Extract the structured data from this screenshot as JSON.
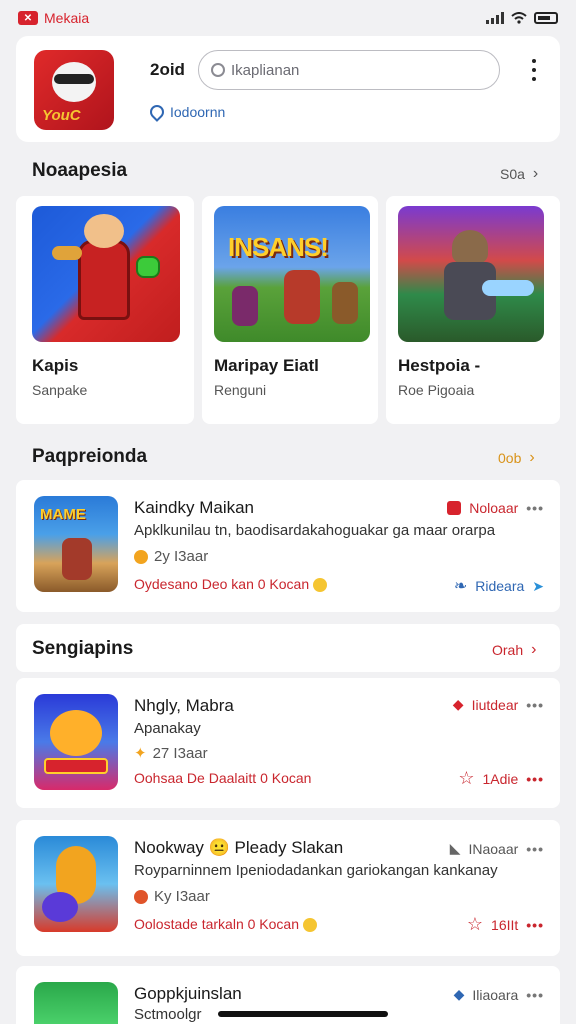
{
  "status": {
    "app_label": "Mekaia"
  },
  "header": {
    "tag": "2oid",
    "search_placeholder": "Ikaplianan",
    "location": "Iodoornn"
  },
  "featured": {
    "title": "Noaapesia",
    "see_all": "S0a",
    "items": [
      {
        "name": "Kapis",
        "sub": "Sanpake"
      },
      {
        "name": "Maripay Eiatl",
        "sub": "Renguni",
        "banner": "INSANS!"
      },
      {
        "name": "Hestpoia -",
        "sub": "Roe Pigoaia"
      }
    ]
  },
  "popular": {
    "title": "Paqpreionda",
    "see_all": "0ob",
    "card": {
      "thumb_text": "MAME",
      "title": "Kaindky Maikan",
      "desc": "Apklkunilau tn, baodisardakahoguakar ga maar orarpa",
      "meta": "2y I3aar",
      "footer": "Oydesano Deo kan 0 Kocan",
      "badge": "Noloaar",
      "more": "•••",
      "action": "Rideara"
    }
  },
  "sengapires": {
    "title": "Sengiapins",
    "see_all": "Orah",
    "cards": [
      {
        "title": "Nhgly, Mabra",
        "desc": "Apanakay",
        "meta": "27 I3aar",
        "footer": "Oohsaa De Daalaitt 0 Kocan",
        "badge": "Iiutdear",
        "more": "•••",
        "rating": "1Adie"
      },
      {
        "title": "Nookway 😐 Pleady Slakan",
        "desc": "Royparninnem Ipeniodadankan gariokangan kankanay",
        "meta": "Ky I3aar",
        "footer": "Oolostade tarkaln 0 Kocan",
        "badge": "INaoaar",
        "more": "•••",
        "rating": "16IIt"
      },
      {
        "title": "Goppkjuinslan",
        "desc": "Sctmoolgr",
        "badge": "Iliaoara",
        "more": "•••"
      }
    ]
  }
}
